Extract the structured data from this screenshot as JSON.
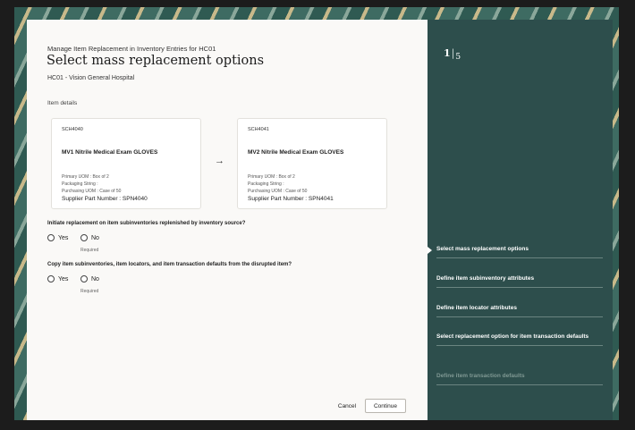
{
  "header": {
    "breadcrumb": "Manage Item Replacement in Inventory Entries for HC01",
    "title": "Select mass replacement options",
    "subtitle": "HC01 - Vision General Hospital"
  },
  "item_details": {
    "label": "Item details",
    "source": {
      "code": "SCH4040",
      "name": "MV1 Nitrile Medical Exam GLOVES",
      "primary_uom": "Primary UOM : Box of 2",
      "packaging_string": "Packaging String :",
      "purchasing_uom": "Purchasing UOM : Case of 50",
      "supplier_part": "Supplier Part Number : SPN4040"
    },
    "arrow": "→",
    "replacement": {
      "code": "SCH4041",
      "name": "MV2 Nitrile Medical Exam GLOVES",
      "primary_uom": "Primary UOM : Box of 2",
      "packaging_string": "Packaging String :",
      "purchasing_uom": "Purchasing UOM : Case of 50",
      "supplier_part": "Supplier Part Number : SPN4041"
    }
  },
  "questions": [
    {
      "text": "Initiate replacement on item subinventories replenished by inventory source?",
      "yes": "Yes",
      "no": "No",
      "required": "Required"
    },
    {
      "text": "Copy item subinventories, item locators, and item transaction defaults from the disrupted item?",
      "yes": "Yes",
      "no": "No",
      "required": "Required"
    }
  ],
  "footer": {
    "cancel": "Cancel",
    "continue": "Continue"
  },
  "train": {
    "current": "1",
    "separator": "|",
    "total": "5",
    "steps": [
      "Select mass replacement options",
      "Define item subinventory attributes",
      "Define item locator attributes",
      "Select replacement option for item transaction defaults",
      "Define item transaction defaults"
    ]
  }
}
